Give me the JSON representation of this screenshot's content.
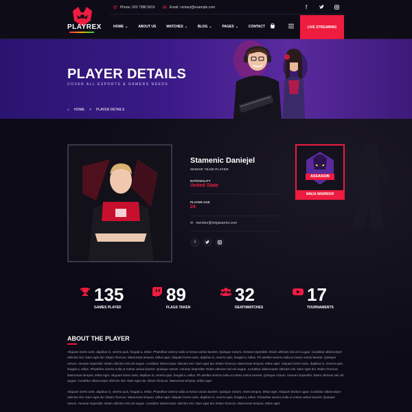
{
  "header": {
    "logo_text": "PLAYREX",
    "phone": "Phone: 020 7388 5819",
    "email": "Email: contact@example.com",
    "nav": [
      {
        "label": "HOME",
        "dropdown": true
      },
      {
        "label": "ABOUT US",
        "dropdown": false
      },
      {
        "label": "MATCHES",
        "dropdown": true
      },
      {
        "label": "BLOG",
        "dropdown": true
      },
      {
        "label": "PAGES",
        "dropdown": true
      },
      {
        "label": "CONTACT",
        "dropdown": false
      }
    ],
    "live_button": "LIVE STREAMING",
    "social_icons": [
      "facebook-icon",
      "twitter-icon",
      "instagram-icon"
    ]
  },
  "hero": {
    "title": "PLAYER DETAILS",
    "subtitle": "COVER ALL ESPORTS & GAMERS NEEDS",
    "breadcrumb": {
      "home": "HOME",
      "separator": ">",
      "current": "PLAYER DETAILS"
    }
  },
  "player": {
    "name": "Stamenic Daniejel",
    "role": "SENIOR TEAM PLAYER",
    "nationality_label": "NATIONALITY",
    "nationality": "United State",
    "age_label": "PLAYER AGE",
    "age": "24",
    "email": "member@ninjawarrior.com",
    "team_logo_text": "ASSASSIN",
    "team_name": "NINJA WARRIOR"
  },
  "stats": [
    {
      "icon": "trophy-icon",
      "value": "135",
      "label": "GAMES PLAYED"
    },
    {
      "icon": "twitch-icon",
      "value": "89",
      "label": "FLAGS TAKEN"
    },
    {
      "icon": "users-icon",
      "value": "32",
      "label": "DEATHMATCHES"
    },
    {
      "icon": "youtube-icon",
      "value": "17",
      "label": "TOURNAMENTS"
    }
  ],
  "about": {
    "title": "ABOUT THE PLAYER",
    "paragraphs": [
      "Aliquam lorem ante, dapibus in, viverra quis, feugiat a, tellus. Phasellus viverra nulla ut metus varius laoreet. Quisque rutrum. Aenean imperdiet. Etiam ultricies nisi vel a ugue. Curabitur ullamcorper ultricies nisi. Nam eget dui. Etiam rhoncus. Maecenas tempus, tellus eget. Aliquam lorem ante, dapibus in, viverra quis, feugiat a, tellus. Ph asellus viverra nulla ut metus varius laoreet. Quisque rutrum. Aenean imperdiet. Etiam ultricies nisi vel augue. Curabitur ullamcorper ultricies nisi. Nam eget dui. Etiam rhoncus. Maecenas tempus, tellus eget. Aliquam lorem ante, dapibus in, viverra quis, feugiat a, tellus. Phasellus viverra nulla ut metus varius laoreet. Quisque rutrum. Aenean imperdiet. Etiam ultricies nisi vel augue. Curabitur ullamcorper ultricies nisi. Nam eget dui. Etiam rhoncus. Maecenas tempus, tellus eget. Aliquam lorem ante, dapibus in, viverra quis, feugiat a, tellus. Ph asellus viverra nulla ut metus varius laoreet. Quisque rutrum. Aenean imperdiet. Etiam ultricies nisi vel augue. Curabitur ullamcorper ultricies nisi. Nam eget dui. Etiam rhoncus. Maecenas tempus, tellus eget.",
      "Aliquam lorem ante, dapibus in, viverra quis, feugiat a, tellus. Phasellus viverra nulla ut metus varius laoreet. Quisque rutrum. Anes tempus, tellus eget. Aliquam lexilum ugue. Curabitur ullamcorper ultricies nisi. Nam eget dui. Etiam rhoncus. Maecenas tempus, tellus eget. Aliquam lorem ante, dapibus in, viverra quis, feugiat a, tellus. Phasellus viverra nulla ut metus varius laoreet. Quisque rutrum. Aenean imperdiet. Etiam ultricies nisi vel augue. Curabitur ullamcorper ultricies nisi. Nam eget dui. Etiam rhoncus. Maecenas tempus, tellus eget."
    ]
  },
  "colors": {
    "accent": "#ee1c3f",
    "background": "#0c0a16",
    "hero": "#3a1a86"
  }
}
